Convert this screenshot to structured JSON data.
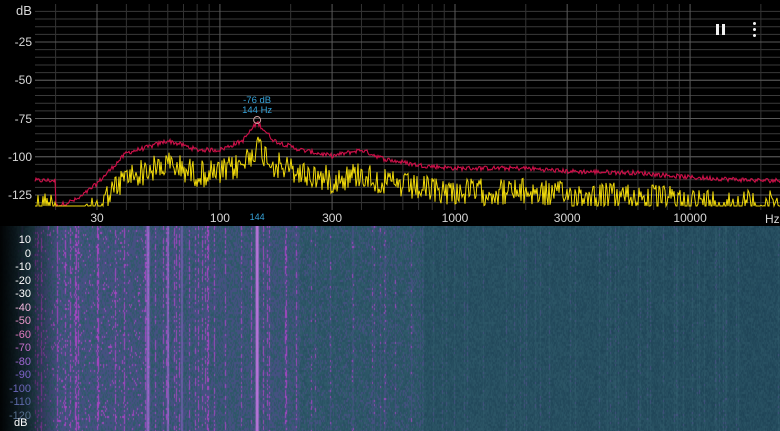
{
  "spectrum": {
    "db_unit": "dB",
    "hz_unit": "Hz",
    "y_ticks": [
      "-25",
      "-50",
      "-75",
      "-100",
      "-125"
    ],
    "y_values": [
      -25,
      -50,
      -75,
      -100,
      -125
    ],
    "x_ticks": [
      "30",
      "100",
      "300",
      "1000",
      "3000",
      "10000"
    ],
    "x_values": [
      30,
      100,
      300,
      1000,
      3000,
      10000
    ],
    "peak": {
      "db_text": "-76 dB",
      "hz_text": "144 Hz",
      "tick_text": "144",
      "freq": 144,
      "db": -76
    },
    "colors": {
      "live": "#f0d90a",
      "max_hold": "#d0104a",
      "accent": "#36a3d9",
      "grid": "#5a5a5a"
    }
  },
  "controls": {
    "pause_icon": "pause-icon",
    "menu_icon": "more-vertical-icon"
  },
  "spectrogram": {
    "db_unit": "dB",
    "scale_labels": [
      {
        "text": "10",
        "color": "#ffffff"
      },
      {
        "text": "0",
        "color": "#ffffff"
      },
      {
        "text": "-10",
        "color": "#ffffff"
      },
      {
        "text": "-20",
        "color": "#ffffff"
      },
      {
        "text": "-30",
        "color": "#ffffff"
      },
      {
        "text": "-40",
        "color": "#f2b9dc"
      },
      {
        "text": "-50",
        "color": "#ec98cc"
      },
      {
        "text": "-60",
        "color": "#e07ac0"
      },
      {
        "text": "-70",
        "color": "#c56fcb"
      },
      {
        "text": "-80",
        "color": "#9d67d2"
      },
      {
        "text": "-90",
        "color": "#7e63c9"
      },
      {
        "text": "-100",
        "color": "#6a66b8"
      },
      {
        "text": "-110",
        "color": "#5c6aa8"
      },
      {
        "text": "-120",
        "color": "#58708e"
      }
    ]
  }
}
